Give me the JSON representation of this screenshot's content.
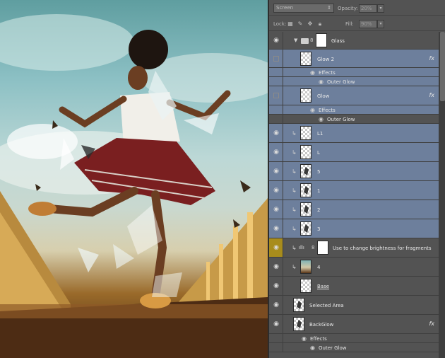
{
  "canvas": {
    "description_icon": "photo-canvas"
  },
  "panel": {
    "blend_mode": "Screen",
    "opacity_label": "Opacity:",
    "opacity_value": "20%",
    "lock_label": "Lock:",
    "fill_label": "Fill:",
    "fill_value": "90%"
  },
  "layers": [
    {
      "name": "Glass",
      "type": "group",
      "visible": true
    },
    {
      "name": "Glow 2",
      "visible": false,
      "fx": "fx",
      "effects_label": "Effects",
      "effect": "Outer Glow"
    },
    {
      "name": "Glow",
      "visible": false,
      "fx": "fx",
      "effects_label": "Effects",
      "effect": "Outer Glow"
    },
    {
      "name": "L1",
      "visible": true
    },
    {
      "name": "L",
      "visible": true
    },
    {
      "name": "5",
      "visible": true
    },
    {
      "name": "1",
      "visible": true
    },
    {
      "name": "2",
      "visible": true
    },
    {
      "name": "3",
      "visible": true
    },
    {
      "name": "Use to change brightness for fragments",
      "visible": true,
      "adjustment": true
    },
    {
      "name": "4",
      "visible": true
    },
    {
      "name": "Base",
      "visible": true
    },
    {
      "name": "Selected Area",
      "visible": true
    },
    {
      "name": "BackGlow",
      "visible": true,
      "fx": "fx",
      "effects_label": "Effects",
      "effect": "Outer Glow"
    }
  ],
  "colors": {
    "selected_row": "#6d7f9c",
    "panel_bg": "#535353",
    "highlight_eye": "#a88c1c"
  }
}
